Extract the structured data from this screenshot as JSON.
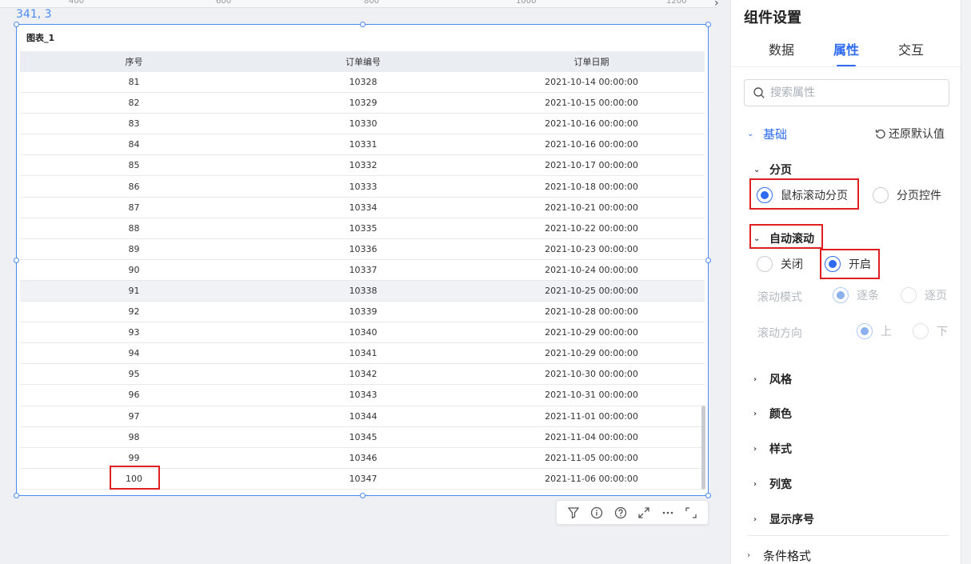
{
  "canvas": {
    "ruler_ticks": [
      "400",
      "600",
      "800",
      "1000",
      "1200"
    ],
    "coordinate_readout": "341, 3"
  },
  "chart": {
    "title": "图表_1",
    "columns": [
      "序号",
      "订单编号",
      "订单日期"
    ],
    "rows": [
      [
        "81",
        "10328",
        "2021-10-14 00:00:00"
      ],
      [
        "82",
        "10329",
        "2021-10-15 00:00:00"
      ],
      [
        "83",
        "10330",
        "2021-10-16 00:00:00"
      ],
      [
        "84",
        "10331",
        "2021-10-16 00:00:00"
      ],
      [
        "85",
        "10332",
        "2021-10-17 00:00:00"
      ],
      [
        "86",
        "10333",
        "2021-10-18 00:00:00"
      ],
      [
        "87",
        "10334",
        "2021-10-21 00:00:00"
      ],
      [
        "88",
        "10335",
        "2021-10-22 00:00:00"
      ],
      [
        "89",
        "10336",
        "2021-10-23 00:00:00"
      ],
      [
        "90",
        "10337",
        "2021-10-24 00:00:00"
      ],
      [
        "91",
        "10338",
        "2021-10-25 00:00:00"
      ],
      [
        "92",
        "10339",
        "2021-10-28 00:00:00"
      ],
      [
        "93",
        "10340",
        "2021-10-29 00:00:00"
      ],
      [
        "94",
        "10341",
        "2021-10-29 00:00:00"
      ],
      [
        "95",
        "10342",
        "2021-10-30 00:00:00"
      ],
      [
        "96",
        "10343",
        "2021-10-31 00:00:00"
      ],
      [
        "97",
        "10344",
        "2021-11-01 00:00:00"
      ],
      [
        "98",
        "10345",
        "2021-11-04 00:00:00"
      ],
      [
        "99",
        "10346",
        "2021-11-05 00:00:00"
      ],
      [
        "100",
        "10347",
        "2021-11-06 00:00:00"
      ]
    ],
    "toolbar_icons": [
      "filter-icon",
      "info-icon",
      "help-icon",
      "expand-icon",
      "more-icon",
      "fullscreen-icon"
    ]
  },
  "panel": {
    "title": "组件设置",
    "tabs": [
      "数据",
      "属性",
      "交互"
    ],
    "active_tab": "属性",
    "search_placeholder": "搜索属性",
    "section_basic": "基础",
    "reset_label": "还原默认值",
    "paging": {
      "label": "分页",
      "option_scroll": "鼠标滚动分页",
      "option_control": "分页控件",
      "selected": "鼠标滚动分页"
    },
    "auto_scroll": {
      "label": "自动滚动",
      "off": "关闭",
      "on": "开启",
      "selected": "开启",
      "mode_label": "滚动模式",
      "mode_item": "逐条",
      "mode_page": "逐页",
      "direction_label": "滚动方向",
      "dir_up": "上",
      "dir_down": "下"
    },
    "collapsed_sections": [
      "风格",
      "颜色",
      "样式",
      "列宽",
      "显示序号"
    ],
    "conditional_format": "条件格式"
  },
  "colors": {
    "accent": "#2e6bf0",
    "highlight_box": "#e02020",
    "selection_border": "#4a8af4"
  }
}
